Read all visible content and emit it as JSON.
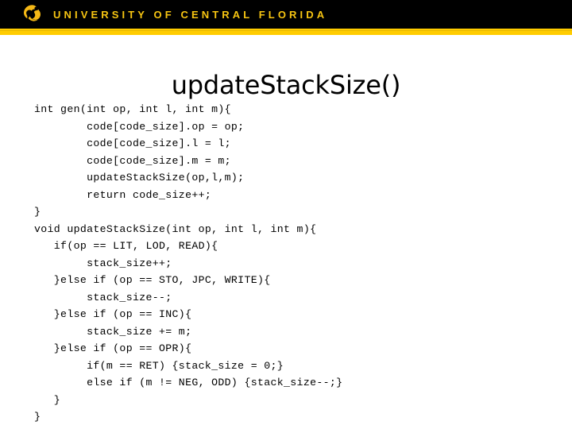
{
  "header": {
    "logo_icon": "ucf-pegasus-logo-icon",
    "institution": "UNIVERSITY OF CENTRAL FLORIDA",
    "bar_color": "#000000",
    "accent_color": "#ffcc00",
    "logo_color": "#f5b816",
    "text_color": "#f7c512"
  },
  "slide": {
    "title": "updateStackSize()",
    "background_color": "#ffffff",
    "text_color": "#000000"
  },
  "code": {
    "language": "c",
    "lines": [
      "int gen(int op, int l, int m){",
      "        code[code_size].op = op;",
      "        code[code_size].l = l;",
      "        code[code_size].m = m;",
      "        updateStackSize(op,l,m);",
      "        return code_size++;",
      "}",
      "void updateStackSize(int op, int l, int m){",
      "   if(op == LIT, LOD, READ){",
      "        stack_size++;",
      "   }else if (op == STO, JPC, WRITE){",
      "        stack_size--;",
      "   }else if (op == INC){",
      "        stack_size += m;",
      "   }else if (op == OPR){",
      "        if(m == RET) {stack_size = 0;}",
      "        else if (m != NEG, ODD) {stack_size--;}",
      "   }",
      "}"
    ]
  }
}
